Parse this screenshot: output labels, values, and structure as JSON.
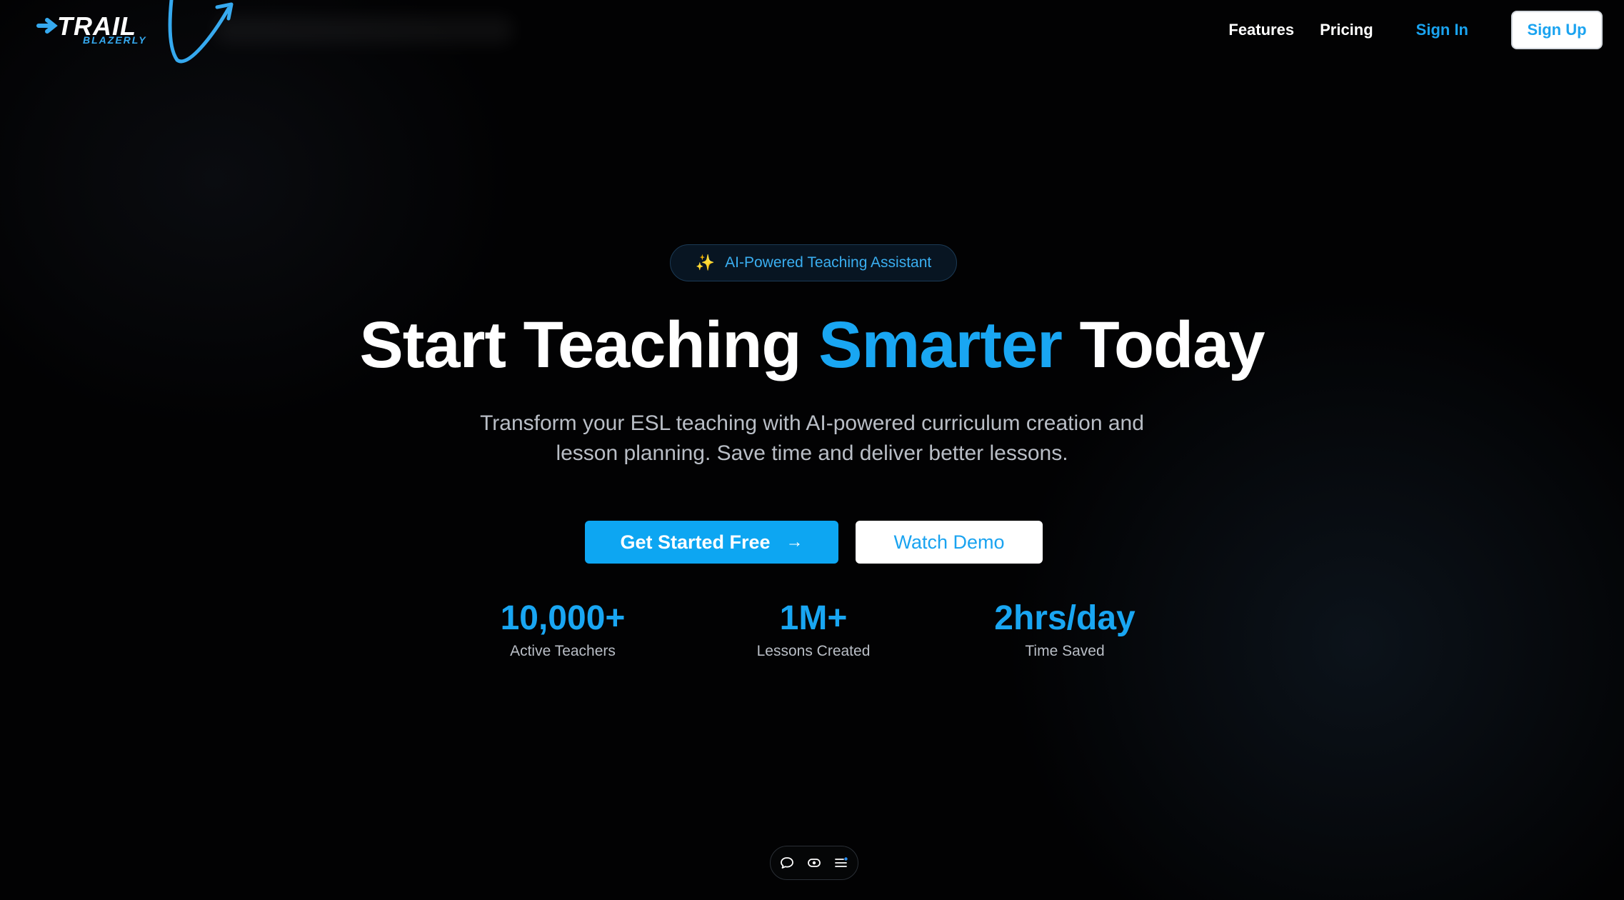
{
  "header": {
    "logo": {
      "primary": "TRAIL",
      "secondary": "BLAZERLY"
    },
    "nav": {
      "features": "Features",
      "pricing": "Pricing",
      "sign_in": "Sign In",
      "sign_up": "Sign Up"
    }
  },
  "hero": {
    "badge": {
      "icon": "sparkles-icon",
      "label": "AI-Powered Teaching Assistant"
    },
    "headline": {
      "part1": "Start Teaching ",
      "accent": "Smarter",
      "part2": " Today"
    },
    "subtext_line1": "Transform your ESL teaching with AI-powered curriculum creation and",
    "subtext_line2": "lesson planning. Save time and deliver better lessons.",
    "cta_primary": "Get Started Free",
    "cta_secondary": "Watch Demo"
  },
  "stats": [
    {
      "value": "10,000+",
      "label": "Active Teachers"
    },
    {
      "value": "1M+",
      "label": "Lessons Created"
    },
    {
      "value": "2hrs/day",
      "label": "Time Saved"
    }
  ],
  "toolbar": {
    "icons": [
      "chat-icon",
      "eye-icon",
      "list-icon"
    ]
  },
  "colors": {
    "accent": "#19a6f2",
    "background": "#020203",
    "badge_text": "#3aaef0",
    "muted_text": "#b9bec6"
  }
}
